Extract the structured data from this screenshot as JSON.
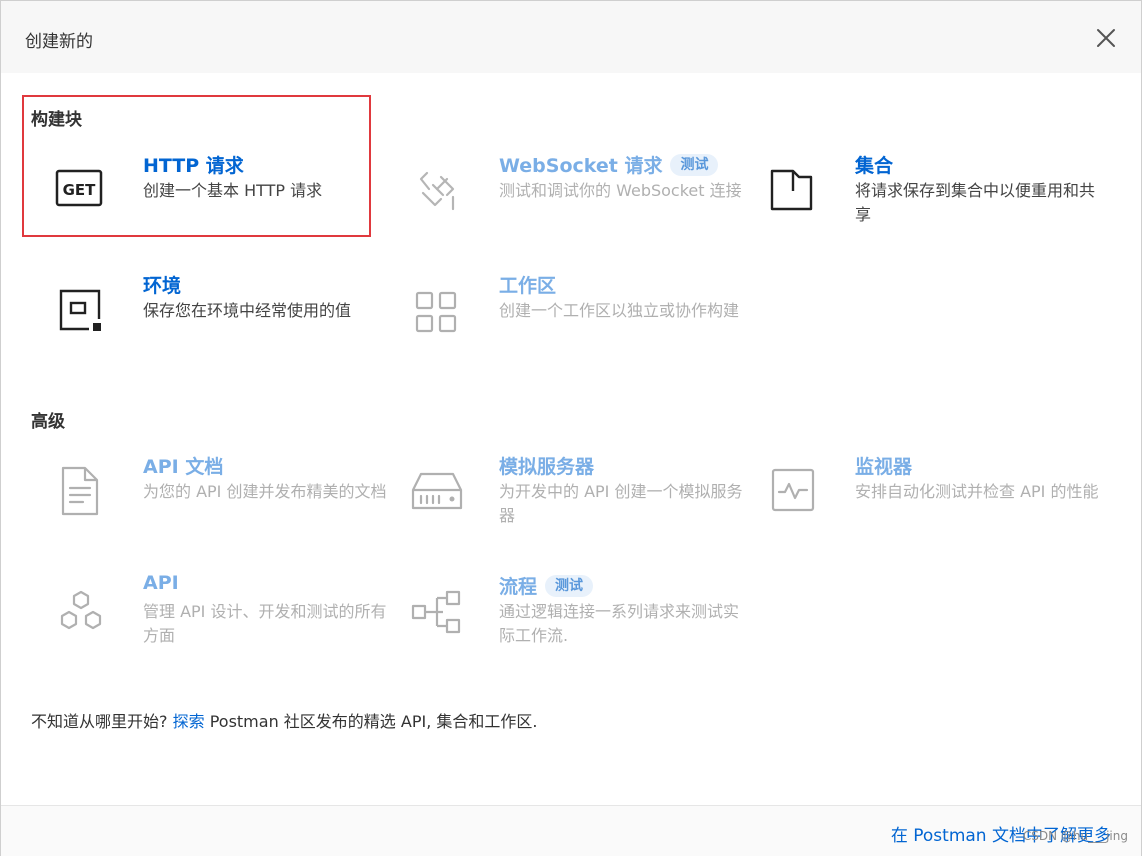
{
  "dialog": {
    "title": "创建新的",
    "close_icon": "close-icon"
  },
  "sections": {
    "building_blocks": "构建块",
    "advanced": "高级"
  },
  "cards": {
    "http": {
      "title": "HTTP 请求",
      "desc": "创建一个基本 HTTP 请求",
      "icon": "get-request-icon"
    },
    "websocket": {
      "title": "WebSocket 请求",
      "badge": "测试",
      "desc": "测试和调试你的 WebSocket 连接",
      "icon": "websocket-icon"
    },
    "collection": {
      "title": "集合",
      "desc": "将请求保存到集合中以便重用和共享",
      "icon": "folder-icon"
    },
    "environment": {
      "title": "环境",
      "desc": "保存您在环境中经常使用的值",
      "icon": "environment-icon"
    },
    "workspace": {
      "title": "工作区",
      "desc": "创建一个工作区以独立或协作构建",
      "icon": "grid-icon"
    },
    "api_docs": {
      "title": "API 文档",
      "desc": "为您的 API 创建并发布精美的文档",
      "icon": "document-icon"
    },
    "mock_server": {
      "title": "模拟服务器",
      "desc": "为开发中的 API 创建一个模拟服务器",
      "icon": "server-icon"
    },
    "monitor": {
      "title": "监视器",
      "desc": "安排自动化测试并检查 API 的性能",
      "icon": "pulse-icon"
    },
    "api": {
      "title": "API",
      "desc": "管理 API 设计、开发和测试的所有方面",
      "icon": "hexagons-icon"
    },
    "flows": {
      "title": "流程",
      "badge": "测试",
      "desc": "通过逻辑连接一系列请求来测试实际工作流.",
      "icon": "flow-icon"
    }
  },
  "footnote": {
    "prefix": "不知道从哪里开始? ",
    "link": "探索",
    "suffix": " Postman 社区发布的精选 API, 集合和工作区."
  },
  "footer": {
    "link": "在 Postman 文档中了解更多"
  },
  "watermark": "CSDN @hu___jing",
  "colors": {
    "accent": "#0265d2",
    "accent_muted": "#7aaee6",
    "highlight_border": "#e0393e",
    "header_bg": "#f7f7f7"
  }
}
